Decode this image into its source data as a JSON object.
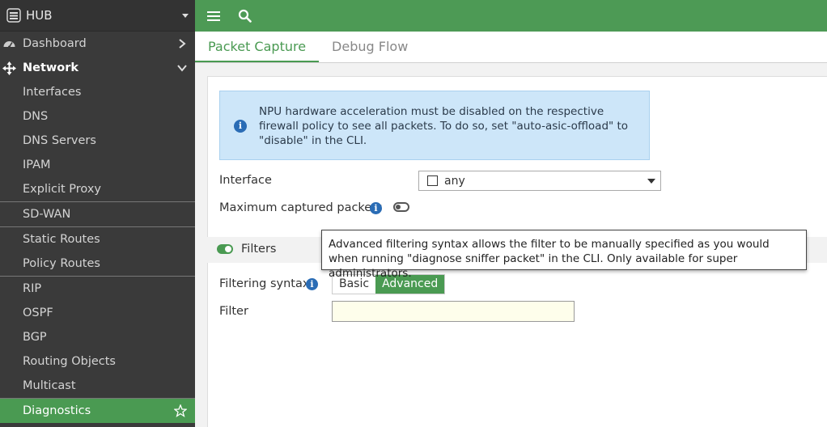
{
  "sidebar": {
    "device": "HUB",
    "items": [
      {
        "label": "Dashboard"
      },
      {
        "label": "Network"
      },
      {
        "label": "Interfaces"
      },
      {
        "label": "DNS"
      },
      {
        "label": "DNS Servers"
      },
      {
        "label": "IPAM"
      },
      {
        "label": "Explicit Proxy"
      },
      {
        "label": "SD-WAN"
      },
      {
        "label": "Static Routes"
      },
      {
        "label": "Policy Routes"
      },
      {
        "label": "RIP"
      },
      {
        "label": "OSPF"
      },
      {
        "label": "BGP"
      },
      {
        "label": "Routing Objects"
      },
      {
        "label": "Multicast"
      },
      {
        "label": "Diagnostics"
      }
    ]
  },
  "tabs": [
    {
      "label": "Packet Capture",
      "active": true
    },
    {
      "label": "Debug Flow",
      "active": false
    }
  ],
  "content": {
    "info_message": "NPU hardware acceleration must be disabled on the respective firewall policy to see all packets. To do so, set \"auto-asic-offload\" to \"disable\" in the CLI.",
    "interface_label": "Interface",
    "interface_value": "any",
    "max_packets_label": "Maximum captured packets",
    "filters_label": "Filters",
    "filtering_syntax_label": "Filtering syntax",
    "syntax_options": [
      "Basic",
      "Advanced"
    ],
    "syntax_selected": "Advanced",
    "filter_label": "Filter",
    "filter_value": "",
    "tooltip": "Advanced filtering syntax allows the filter to be manually specified as you would when running \"diagnose sniffer packet\" in the CLI. Only available for super administrators."
  },
  "colors": {
    "brand_green": "#4d9a55",
    "sidebar_bg": "#3a3a3a",
    "info_bg": "#cde6f9"
  }
}
